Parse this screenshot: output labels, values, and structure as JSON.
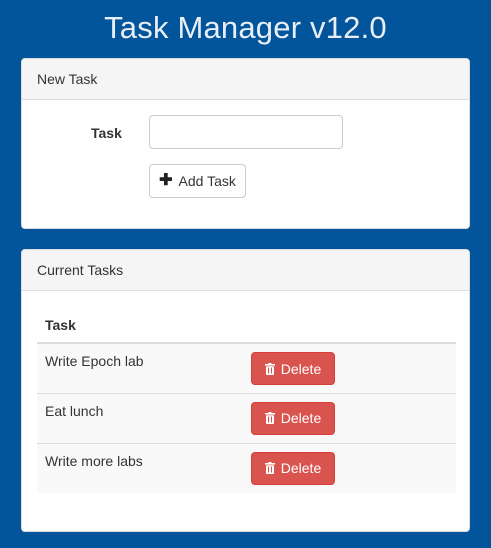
{
  "app": {
    "title": "Task Manager v12.0"
  },
  "new_task": {
    "heading": "New Task",
    "field_label": "Task",
    "field_value": "",
    "add_button_label": "Add Task",
    "add_icon": "plus-icon"
  },
  "current_tasks": {
    "heading": "Current Tasks",
    "column_header": "Task",
    "delete_label": "Delete",
    "delete_icon": "trash-icon",
    "delete_color": "#d9534f",
    "rows": [
      {
        "name": "Write Epoch lab"
      },
      {
        "name": "Eat lunch"
      },
      {
        "name": "Write more labs"
      }
    ]
  },
  "colors": {
    "background": "#02549b",
    "title": "#e8eef6"
  }
}
